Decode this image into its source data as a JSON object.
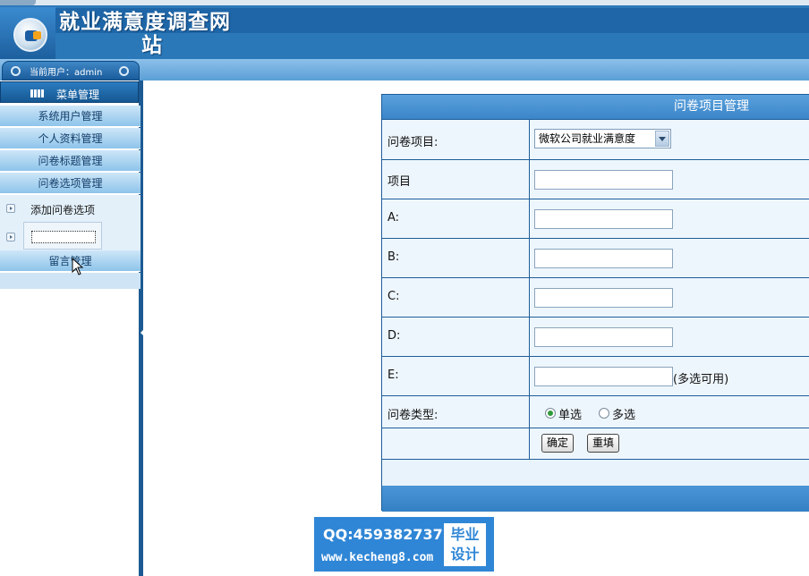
{
  "header": {
    "site_title_line1": "就业满意度调查网",
    "site_title_line2": "站",
    "current_user_label": "当前用户：admin"
  },
  "sidebar": {
    "menu_head": "菜单管理",
    "items": [
      {
        "label": "系统用户管理"
      },
      {
        "label": "个人资料管理"
      },
      {
        "label": "问卷标题管理"
      },
      {
        "label": "问卷选项管理"
      }
    ],
    "submenu": {
      "add_link": "添加问卷选项"
    },
    "message_item": "留言管理"
  },
  "panel": {
    "title": "问卷项目管理",
    "questionnaire_label": "问卷项目:",
    "questionnaire_selected": "微软公司就业满意度",
    "item_label": "项目",
    "option_a_label": "A:",
    "option_b_label": "B:",
    "option_c_label": "C:",
    "option_d_label": "D:",
    "option_e_label": "E:",
    "option_e_note": "(多选可用)",
    "type_label": "问卷类型:",
    "type_single": "单选",
    "type_multi": "多选",
    "type_selected": "单选",
    "confirm_button": "确定",
    "reset_button": "重填"
  },
  "watermark": {
    "qq": "QQ:459382737",
    "url": "www.kecheng8.com",
    "badge_line1": "毕业",
    "badge_line2": "设计"
  },
  "colors": {
    "header_blue": "#1e66a8",
    "sidebar_item": "#8ec4ea",
    "panel_bg": "#eef6fd",
    "panel_border": "#1d5e9a"
  }
}
